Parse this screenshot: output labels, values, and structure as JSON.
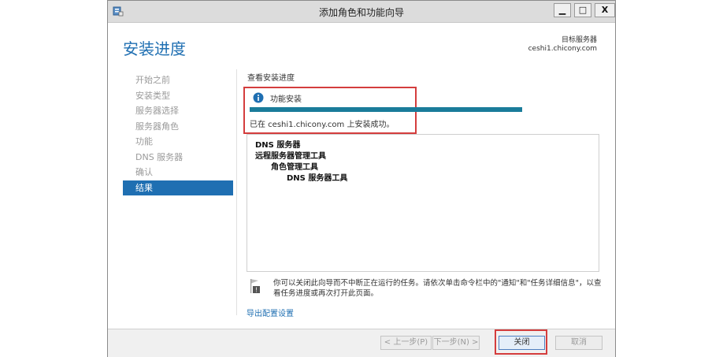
{
  "window": {
    "title": "添加角色和功能向导",
    "controls": {
      "minimize": "▁",
      "maximize": "□",
      "close": "X"
    }
  },
  "header": {
    "page_title": "安装进度",
    "target_server_label": "目标服务器",
    "target_server_name": "ceshi1.chicony.com"
  },
  "steps": [
    {
      "label": "开始之前"
    },
    {
      "label": "安装类型"
    },
    {
      "label": "服务器选择"
    },
    {
      "label": "服务器角色"
    },
    {
      "label": "功能"
    },
    {
      "label": "DNS 服务器"
    },
    {
      "label": "确认"
    },
    {
      "label": "结果",
      "active": true
    }
  ],
  "main": {
    "section_label": "查看安装进度",
    "feature_install_label": "功能安装",
    "progress_fraction": 1.0,
    "success_text": "已在 ceshi1.chicony.com 上安装成功。",
    "results": [
      {
        "text": "DNS 服务器",
        "indent": 0
      },
      {
        "text": "远程服务器管理工具",
        "indent": 0
      },
      {
        "text": "角色管理工具",
        "indent": 1
      },
      {
        "text": "DNS 服务器工具",
        "indent": 2
      }
    ],
    "notice_text": "你可以关闭此向导而不中断正在运行的任务。请依次单击命令栏中的\"通知\"和\"任务详细信息\"，以查看任务进度或再次打开此页面。",
    "export_link": "导出配置设置"
  },
  "buttons": {
    "prev": "< 上一步(P)",
    "next": "下一步(N) >",
    "close": "关闭",
    "cancel": "取消"
  },
  "colors": {
    "accent": "#1f6fb2",
    "progress": "#1a7c9a",
    "highlight": "#d43d3d"
  }
}
